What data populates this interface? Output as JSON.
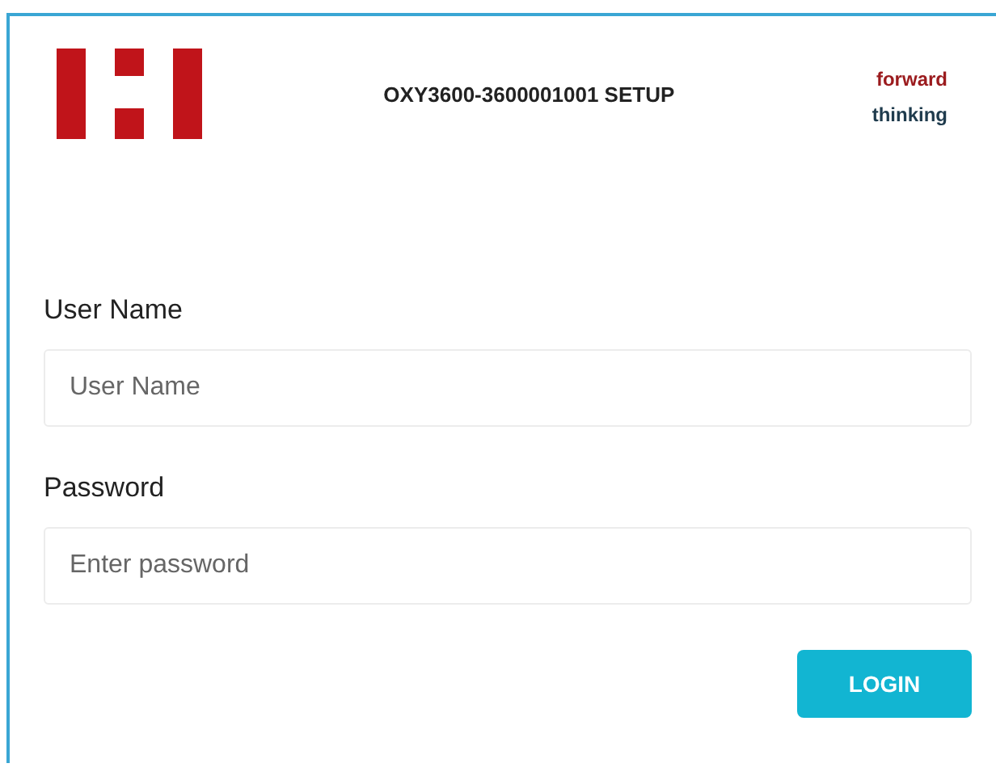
{
  "header": {
    "title": "OXY3600-3600001001 SETUP",
    "tagline": [
      "forward",
      "thinking"
    ]
  },
  "fields": [
    {
      "label": "User Name",
      "placeholder": "User Name"
    },
    {
      "label": "Password",
      "placeholder": "Enter password"
    }
  ],
  "buttons": [
    "LOGIN"
  ]
}
